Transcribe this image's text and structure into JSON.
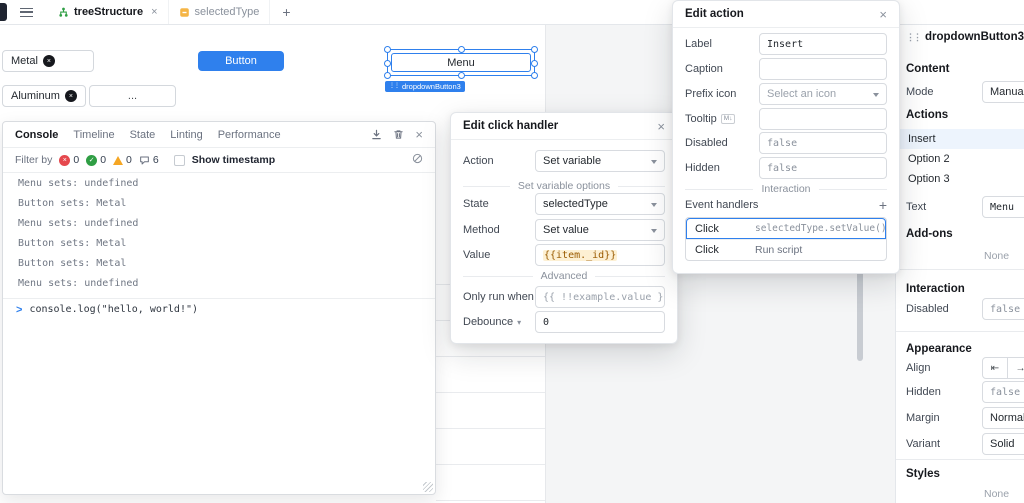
{
  "accent_color": "#2f80ed",
  "topbar": {
    "tabs": [
      {
        "label": "treeStructure",
        "close": "×"
      },
      {
        "label": "selectedType"
      }
    ],
    "new_tab_label": "+"
  },
  "canvas": {
    "metal_select_value": "Metal",
    "metal_clear": "×",
    "aluminum_select_value": "Aluminum",
    "aluminum_clear": "×",
    "button_label": "Button",
    "menu_button_label": "Menu",
    "selected_component_tag": "dropdownButton3",
    "dots_button_label": "..."
  },
  "console_panel": {
    "tabs": [
      "Console",
      "Timeline",
      "State",
      "Linting",
      "Performance"
    ],
    "filter_label": "Filter by",
    "error_count": "0",
    "success_count": "0",
    "warning_count": "0",
    "message_count": "6",
    "show_timestamp_label": "Show timestamp",
    "logs": [
      "Menu sets: undefined",
      "Button sets: Metal",
      "Menu sets: undefined",
      "Button sets: Metal",
      "Button sets: Metal",
      "Menu sets: undefined"
    ],
    "prompt": ">",
    "input_value": "console.log(\"hello, world!\")",
    "close": "×"
  },
  "click_handler_modal": {
    "title": "Edit click handler",
    "close": "×",
    "action_label": "Action",
    "action_value": "Set variable",
    "options_divider": "Set variable options",
    "state_label": "State",
    "state_value": "selectedType",
    "method_label": "Method",
    "method_value": "Set value",
    "value_label": "Value",
    "value_value": "{{item._id}}",
    "advanced_divider": "Advanced",
    "only_run_when_label": "Only run when",
    "only_run_when_placeholder": "{{ !!example.value }}",
    "debounce_label": "Debounce",
    "debounce_value": "0"
  },
  "edit_action_modal": {
    "title": "Edit action",
    "close": "×",
    "label_label": "Label",
    "label_value": "Insert",
    "caption_label": "Caption",
    "caption_value": "",
    "prefix_icon_label": "Prefix icon",
    "prefix_icon_placeholder": "Select an icon",
    "tooltip_label": "Tooltip",
    "tooltip_badge": "M↓",
    "disabled_label": "Disabled",
    "disabled_value": "false",
    "hidden_label": "Hidden",
    "hidden_value": "false",
    "interaction_divider": "Interaction",
    "event_handlers_label": "Event handlers",
    "add_handler_label": "+",
    "handlers": [
      {
        "event": "Click",
        "action": "selectedType.setValue()"
      },
      {
        "event": "Click",
        "action": "Run script"
      }
    ]
  },
  "inspector": {
    "title": "dropdownButton3",
    "content_header": "Content",
    "mode_label": "Mode",
    "mode_value": "Manual",
    "actions_header": "Actions",
    "action_items": [
      "Insert",
      "Option 2",
      "Option 3"
    ],
    "text_label": "Text",
    "text_value": "Menu",
    "addons_header": "Add-ons",
    "addons_value": "None",
    "interaction_header": "Interaction",
    "disabled_label": "Disabled",
    "disabled_value": "false",
    "appearance_header": "Appearance",
    "align_label": "Align",
    "align_left_icon": "⇤",
    "align_right_icon": "→",
    "hidden_label": "Hidden",
    "hidden_value": "false",
    "margin_label": "Margin",
    "margin_value": "Normal",
    "variant_label": "Variant",
    "variant_value": "Solid",
    "styles_header": "Styles",
    "styles_value": "None"
  }
}
